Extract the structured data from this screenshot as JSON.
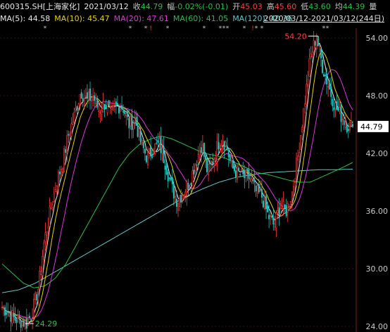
{
  "header": {
    "code": "600315.SH[上海家化]",
    "date": "2021/03/12",
    "close_label": "收",
    "close_value": "44.79",
    "change_label": "幅",
    "change_value": "-0.02%(-0.01)",
    "open_label": "开",
    "open_value": "45.03",
    "high_label": "高",
    "high_value": "45.60",
    "low_label": "低",
    "low_value": "43.60",
    "avg_label": "均",
    "avg_value": "44.39",
    "vol_label": "量"
  },
  "ma": {
    "ma5": "MA(5): 44.58",
    "ma10": "MA(10): 45.47",
    "ma20": "MA(20): 47.61",
    "ma60": "MA(60): 41.05",
    "ma120": "MA(120): 40.36",
    "range": "2020/03/12-2021/03/12(244日)"
  },
  "axis": {
    "labels": [
      "54.00",
      "48.00",
      "42.00",
      "36.00",
      "30.00",
      "24.00"
    ],
    "current_price": "44.79"
  },
  "annotations": {
    "high": "54.20",
    "low": "24.29"
  },
  "colors": {
    "up": "#ff3b3b",
    "down": "#20c0c0",
    "ma5": "#e8e8e8",
    "ma10": "#e8d000",
    "ma20": "#e030e0",
    "ma60": "#20c040",
    "ma120": "#5ec7c9"
  },
  "chart_data": {
    "type": "candlestick",
    "ylim": [
      24,
      55
    ],
    "y_ticks": [
      54,
      48,
      42,
      36,
      30,
      24
    ],
    "x_range": [
      "2020/03/12",
      "2021/03/12"
    ],
    "trading_days": 244,
    "last_close": 44.79,
    "period_high": 54.2,
    "period_low": 24.29,
    "price_anchors": [
      26.0,
      25.5,
      24.8,
      24.6,
      24.29,
      25.5,
      28.0,
      33.0,
      36.0,
      39.0,
      41.0,
      44.0,
      46.0,
      48.5,
      47.5,
      48.0,
      46.5,
      47.2,
      46.0,
      47.0,
      46.8,
      45.0,
      45.5,
      43.0,
      41.5,
      42.5,
      43.0,
      41.0,
      38.5,
      37.0,
      38.0,
      39.0,
      41.0,
      43.0,
      40.0,
      41.5,
      43.5,
      43.0,
      40.5,
      40.0,
      39.5,
      39.5,
      38.0,
      37.5,
      35.5,
      34.5,
      36.5,
      36.0,
      38.0,
      42.0,
      47.0,
      52.0,
      54.2,
      51.0,
      49.0,
      47.0,
      46.0,
      45.0,
      44.79
    ],
    "ma60_anchors": [
      30.5,
      29.5,
      28.5,
      28.0,
      28.2,
      29.0,
      30.5,
      32.5,
      34.5,
      36.5,
      38.5,
      40.5,
      42.0,
      43.0,
      43.5,
      43.8,
      43.5,
      43.0,
      42.5,
      42.0,
      41.8,
      41.5,
      41.0,
      40.5,
      40.0,
      39.8,
      39.5,
      39.2,
      39.0,
      39.0,
      39.5,
      40.0,
      40.5,
      41.05
    ],
    "ma120_anchors": [
      27.5,
      27.8,
      28.5,
      29.5,
      30.5,
      31.5,
      32.5,
      33.5,
      34.5,
      35.5,
      36.5,
      37.5,
      38.3,
      39.0,
      39.5,
      39.8,
      40.0,
      40.1,
      40.2,
      40.3,
      40.3,
      40.36
    ]
  }
}
